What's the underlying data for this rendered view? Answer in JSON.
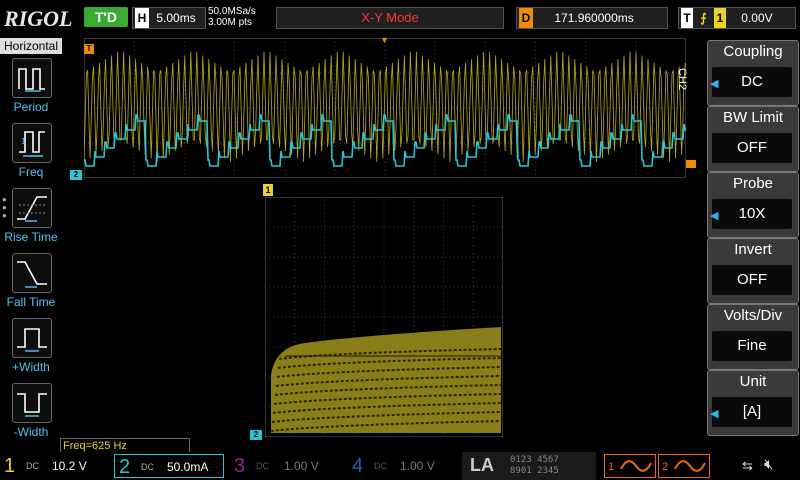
{
  "topbar": {
    "brand": "RIGOL",
    "trigger_status": "T'D",
    "horizontal": {
      "label": "H",
      "value": "5.00ms"
    },
    "sample_rate": "50.0MSa/s",
    "memory_depth": "3.00M pts",
    "mode": "X-Y Mode",
    "delay": {
      "label": "D",
      "value": "171.960000ms"
    },
    "trigger": {
      "label": "T",
      "source": "1",
      "level": "0.00V"
    }
  },
  "left_panel": {
    "title": "Horizontal",
    "items": [
      {
        "label": "Period",
        "icon": "period-icon"
      },
      {
        "label": "Freq",
        "icon": "freq-icon"
      },
      {
        "label": "Rise Time",
        "icon": "rise-time-icon"
      },
      {
        "label": "Fall Time",
        "icon": "fall-time-icon"
      },
      {
        "label": "+Width",
        "icon": "pos-width-icon"
      },
      {
        "label": "-Width",
        "icon": "neg-width-icon"
      }
    ]
  },
  "right_menu": {
    "channel_tag": "CH2",
    "items": [
      {
        "title": "Coupling",
        "value": "DC",
        "has_arrow": true
      },
      {
        "title": "BW Limit",
        "value": "OFF",
        "has_arrow": false
      },
      {
        "title": "Probe",
        "value": "10X",
        "has_arrow": true
      },
      {
        "title": "Invert",
        "value": "OFF",
        "has_arrow": false
      },
      {
        "title": "Volts/Div",
        "value": "Fine",
        "has_arrow": false
      },
      {
        "title": "Unit",
        "value": "[A]",
        "has_arrow": true
      }
    ]
  },
  "markers": {
    "ch1": "1",
    "ch2": "2",
    "trigger_pos": "T"
  },
  "measurement": {
    "freq": "Freq=625 Hz"
  },
  "channels": [
    {
      "num": "1",
      "coupling": "DC",
      "scale": "10.2 V",
      "color": "#f0d020",
      "active": true
    },
    {
      "num": "2",
      "coupling": "DC",
      "scale": "50.0mA",
      "color": "#29c5d6",
      "active": true
    },
    {
      "num": "3",
      "coupling": "DC",
      "scale": "1.00 V",
      "color": "#8b2a8b",
      "active": false
    },
    {
      "num": "4",
      "coupling": "DC",
      "scale": "1.00 V",
      "color": "#2a5aa8",
      "active": false
    }
  ],
  "logic": {
    "label": "LA",
    "row1": "0123 4567",
    "row2": "8901 2345"
  },
  "generators": [
    {
      "num": "1",
      "color": "#f06a00"
    },
    {
      "num": "2",
      "color": "#f06a00"
    }
  ],
  "colors": {
    "ch1": "#f0d020",
    "ch2": "#29c5d6",
    "accent_blue": "#29b6f6",
    "trigger_green": "#3aaa35",
    "delay_orange": "#f08c00",
    "mode_red": "#ff3333"
  }
}
